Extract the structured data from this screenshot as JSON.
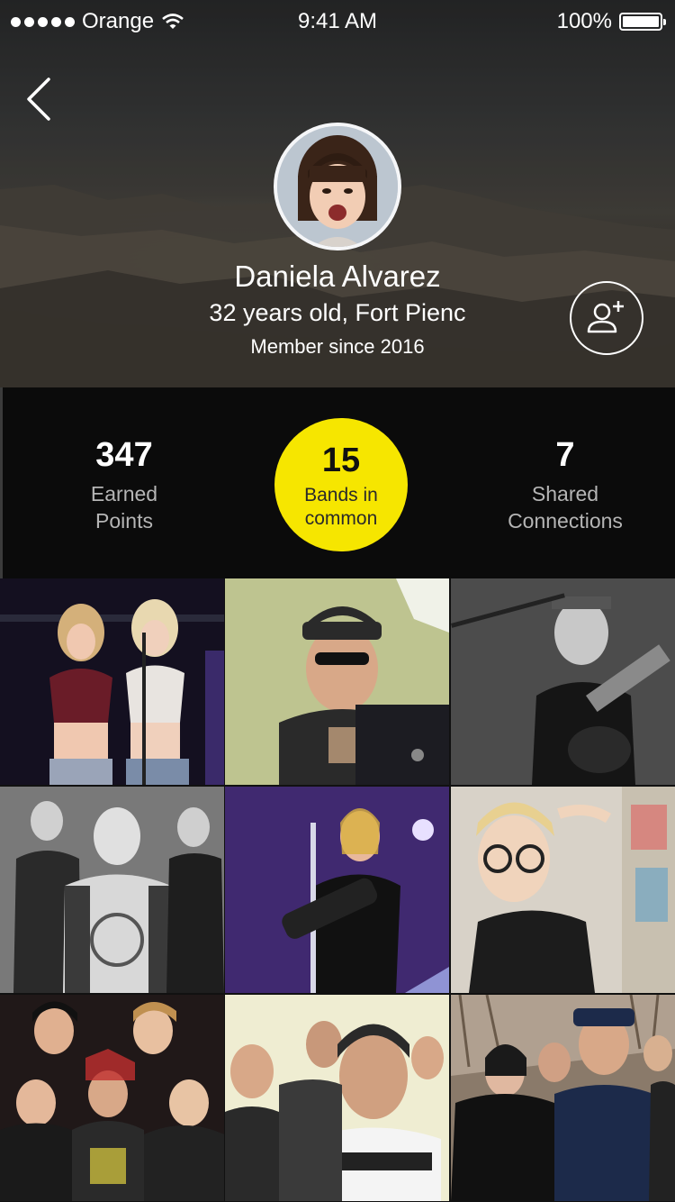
{
  "status_bar": {
    "carrier": "Orange",
    "time": "9:41 AM",
    "battery": "100%",
    "battery_level": 1.0
  },
  "profile": {
    "name": "Daniela Alvarez",
    "details": "32 years old, Fort Pienc",
    "member_since": "Member since 2016"
  },
  "stats": {
    "points": {
      "value": "347",
      "label_line1": "Earned",
      "label_line2": "Points"
    },
    "bands": {
      "value": "15",
      "label_line1": "Bands in",
      "label_line2": "common"
    },
    "connections": {
      "value": "7",
      "label_line1": "Shared",
      "label_line2": "Connections"
    }
  },
  "icons": {
    "back": "chevron-left-icon",
    "add_friend": "add-user-icon",
    "wifi": "wifi-icon"
  },
  "colors": {
    "accent": "#f6e600",
    "stats_background": "#0b0b0b"
  },
  "band_photos": [
    {
      "name": "band-photo-1"
    },
    {
      "name": "band-photo-2"
    },
    {
      "name": "band-photo-3"
    },
    {
      "name": "band-photo-4"
    },
    {
      "name": "band-photo-5"
    },
    {
      "name": "band-photo-6"
    },
    {
      "name": "band-photo-7"
    },
    {
      "name": "band-photo-8"
    },
    {
      "name": "band-photo-9"
    }
  ]
}
